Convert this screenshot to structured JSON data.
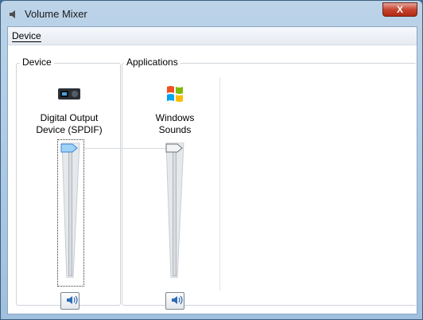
{
  "window": {
    "title": "Volume Mixer",
    "close_label": "X"
  },
  "menu": {
    "items": [
      {
        "label": "Device"
      }
    ]
  },
  "device_group": {
    "label": "Device"
  },
  "applications_group": {
    "label": "Applications"
  },
  "channels": [
    {
      "name_line1": "Digital Output",
      "name_line2": "Device (SPDIF)",
      "icon": "speaker-device-icon",
      "volume_fraction": 1.0
    },
    {
      "name_line1": "Windows",
      "name_line2": "Sounds",
      "icon": "windows-logo-icon",
      "volume_fraction": 1.0
    }
  ],
  "colors": {
    "accent": "#3c7fd6",
    "close": "#c7442f"
  }
}
